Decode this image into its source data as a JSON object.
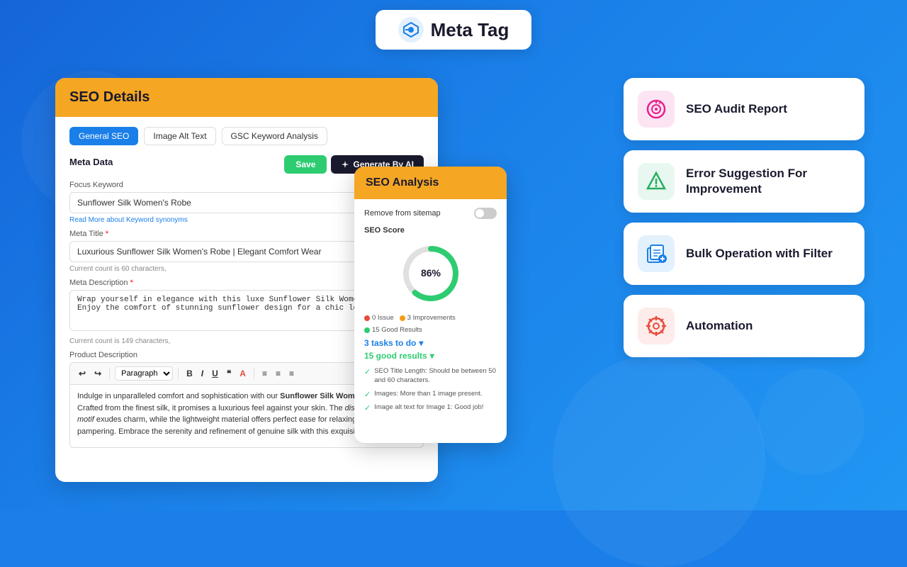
{
  "header": {
    "title": "Meta Tag",
    "logo_alt": "meta-tag-logo"
  },
  "seo_details": {
    "title": "SEO Details",
    "tabs": [
      {
        "label": "General SEO",
        "active": true
      },
      {
        "label": "Image Alt Text",
        "active": false
      },
      {
        "label": "GSC Keyword Analysis",
        "active": false
      }
    ],
    "meta_data_label": "Meta Data",
    "save_button": "Save",
    "generate_button": "Generate By AI",
    "focus_keyword_label": "Focus Keyword",
    "focus_keyword_value": "Sunflower Silk Women's Robe",
    "keyword_hint": "Read More about Keyword synonyms",
    "meta_title_label": "Meta Title",
    "meta_title_required": true,
    "meta_title_value": "Luxurious Sunflower Silk Women's Robe | Elegant Comfort Wear",
    "meta_title_count": "Current count is 60 characters,",
    "meta_description_label": "Meta Description",
    "meta_description_required": true,
    "meta_description_value": "Wrap yourself in elegance with this luxe Sunflower Silk Women's Robe. Enjoy the comfort of stunning sunflower design for a chic look.",
    "meta_description_count": "Current count is 149 characters,",
    "product_description_label": "Product Description",
    "editor_toolbar": {
      "undo": "↩",
      "redo": "↪",
      "paragraph": "Paragraph",
      "bold": "B",
      "italic": "I",
      "underline": "U",
      "quote": "❝",
      "color": "A",
      "align_left": "≡",
      "align_center": "≡",
      "align_right": "≡"
    },
    "editor_content": "Indulge in unparalleled comfort and sophistication with our Sunflower Silk Women's Robe. Crafted from the finest silk, it promises a luxurious feel against your skin. The distinctive sunflower motif exudes charm, while the lightweight material offers perfect ease for relaxing or post-shower pampering. Embrace the serenity and refinement of genuine silk with this exquisite robe."
  },
  "seo_analysis": {
    "title": "SEO Analysis",
    "remove_from_sitemap": "Remove from sitemap",
    "seo_score_label": "SEO Score",
    "score_value": 86,
    "score_text": "86%",
    "stats": {
      "issues": "0 Issue",
      "improvements": "3 Improvements",
      "good_results": "15 Good Results"
    },
    "tasks_todo": "3 tasks to do",
    "good_results_label": "15 good results",
    "results": [
      {
        "text": "SEO Title Length: Should be between 50 and 60 characters."
      },
      {
        "text": "Images: More than 1 image present."
      },
      {
        "text": "Image alt text for Image 1: Good job!"
      }
    ]
  },
  "feature_cards": [
    {
      "id": "seo-audit",
      "title": "SEO Audit Report",
      "icon_color": "#e91e8c",
      "bg_color": "#fce4f3"
    },
    {
      "id": "error-suggestion",
      "title": "Error Suggestion For Improvement",
      "icon_color": "#27ae60",
      "bg_color": "#e8f8f0"
    },
    {
      "id": "bulk-operation",
      "title": "Bulk Operation with Filter",
      "icon_color": "#1a7fe8",
      "bg_color": "#e3f0fd"
    },
    {
      "id": "automation",
      "title": "Automation",
      "icon_color": "#e74c3c",
      "bg_color": "#fdecea"
    }
  ]
}
